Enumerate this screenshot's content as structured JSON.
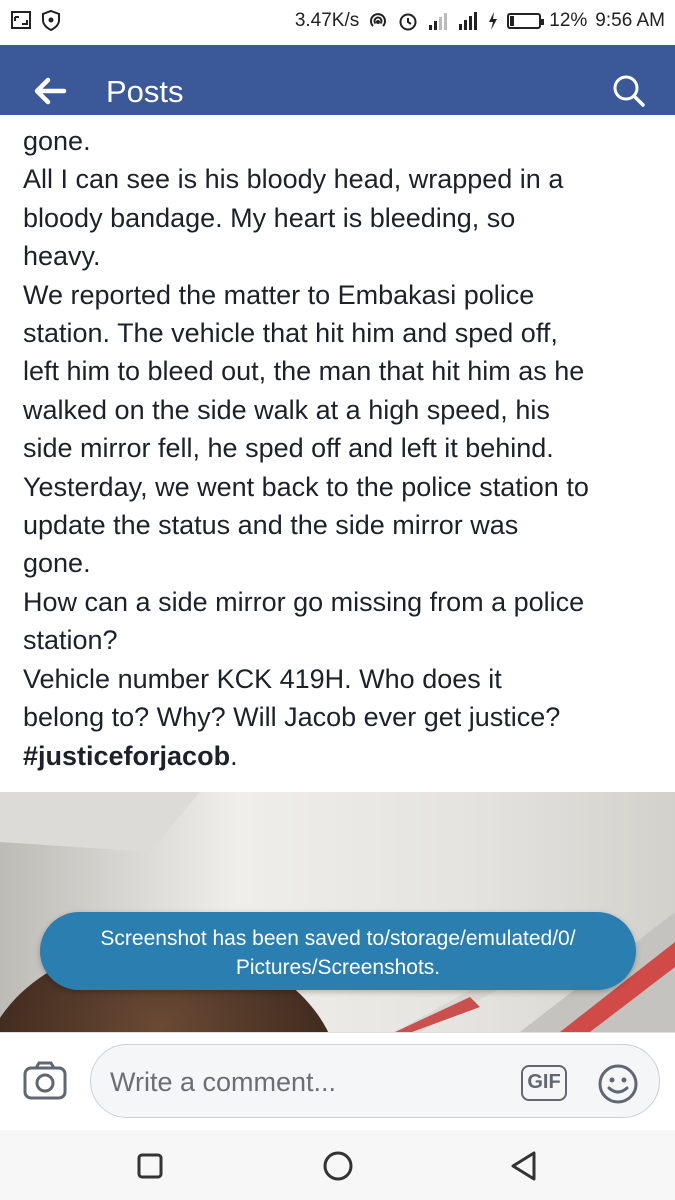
{
  "status_bar": {
    "speed": "3.47K/s",
    "battery": "12%",
    "time": "9:56 AM",
    "icons": [
      "screenshot-icon",
      "shield-icon",
      "hotspot-icon",
      "alarm-icon",
      "signal-icon",
      "data-signal-icon",
      "charging-icon",
      "battery-icon"
    ]
  },
  "header": {
    "title": "Posts",
    "back_icon": "arrow-left-icon",
    "search_icon": "search-icon",
    "bar_color": "#3b5998"
  },
  "post": {
    "lines": [
      "gone.",
      "All I can see is his bloody head, wrapped in a",
      "bloody bandage. My heart is bleeding, so",
      "heavy.",
      "We reported the matter to Embakasi police",
      "station. The vehicle that hit him and sped off,",
      "left him to bleed out, the man that hit him as he",
      "walked on the side walk at a high speed, his",
      "side mirror fell, he sped off and left it behind.",
      "Yesterday, we went back to the police station to",
      "update the status and the side mirror was",
      "gone.",
      "How can a side mirror go missing from a police",
      "station?",
      "Vehicle number  KCK 419H. Who does it",
      "belong to? Why? Will Jacob ever get justice?"
    ],
    "hashtag": "#justiceforjacob",
    "hashtag_suffix": "."
  },
  "toast": {
    "line1": "Screenshot has been saved to/storage/emulated/0/",
    "line2": "Pictures/Screenshots.",
    "color": "#2a7fb0"
  },
  "comment_bar": {
    "placeholder": "Write a comment...",
    "gif_label": "GIF",
    "camera_icon": "camera-icon",
    "emoji_icon": "emoji-icon"
  },
  "nav_bar": {
    "icons": [
      "recent-apps-icon",
      "home-icon",
      "back-icon"
    ]
  }
}
